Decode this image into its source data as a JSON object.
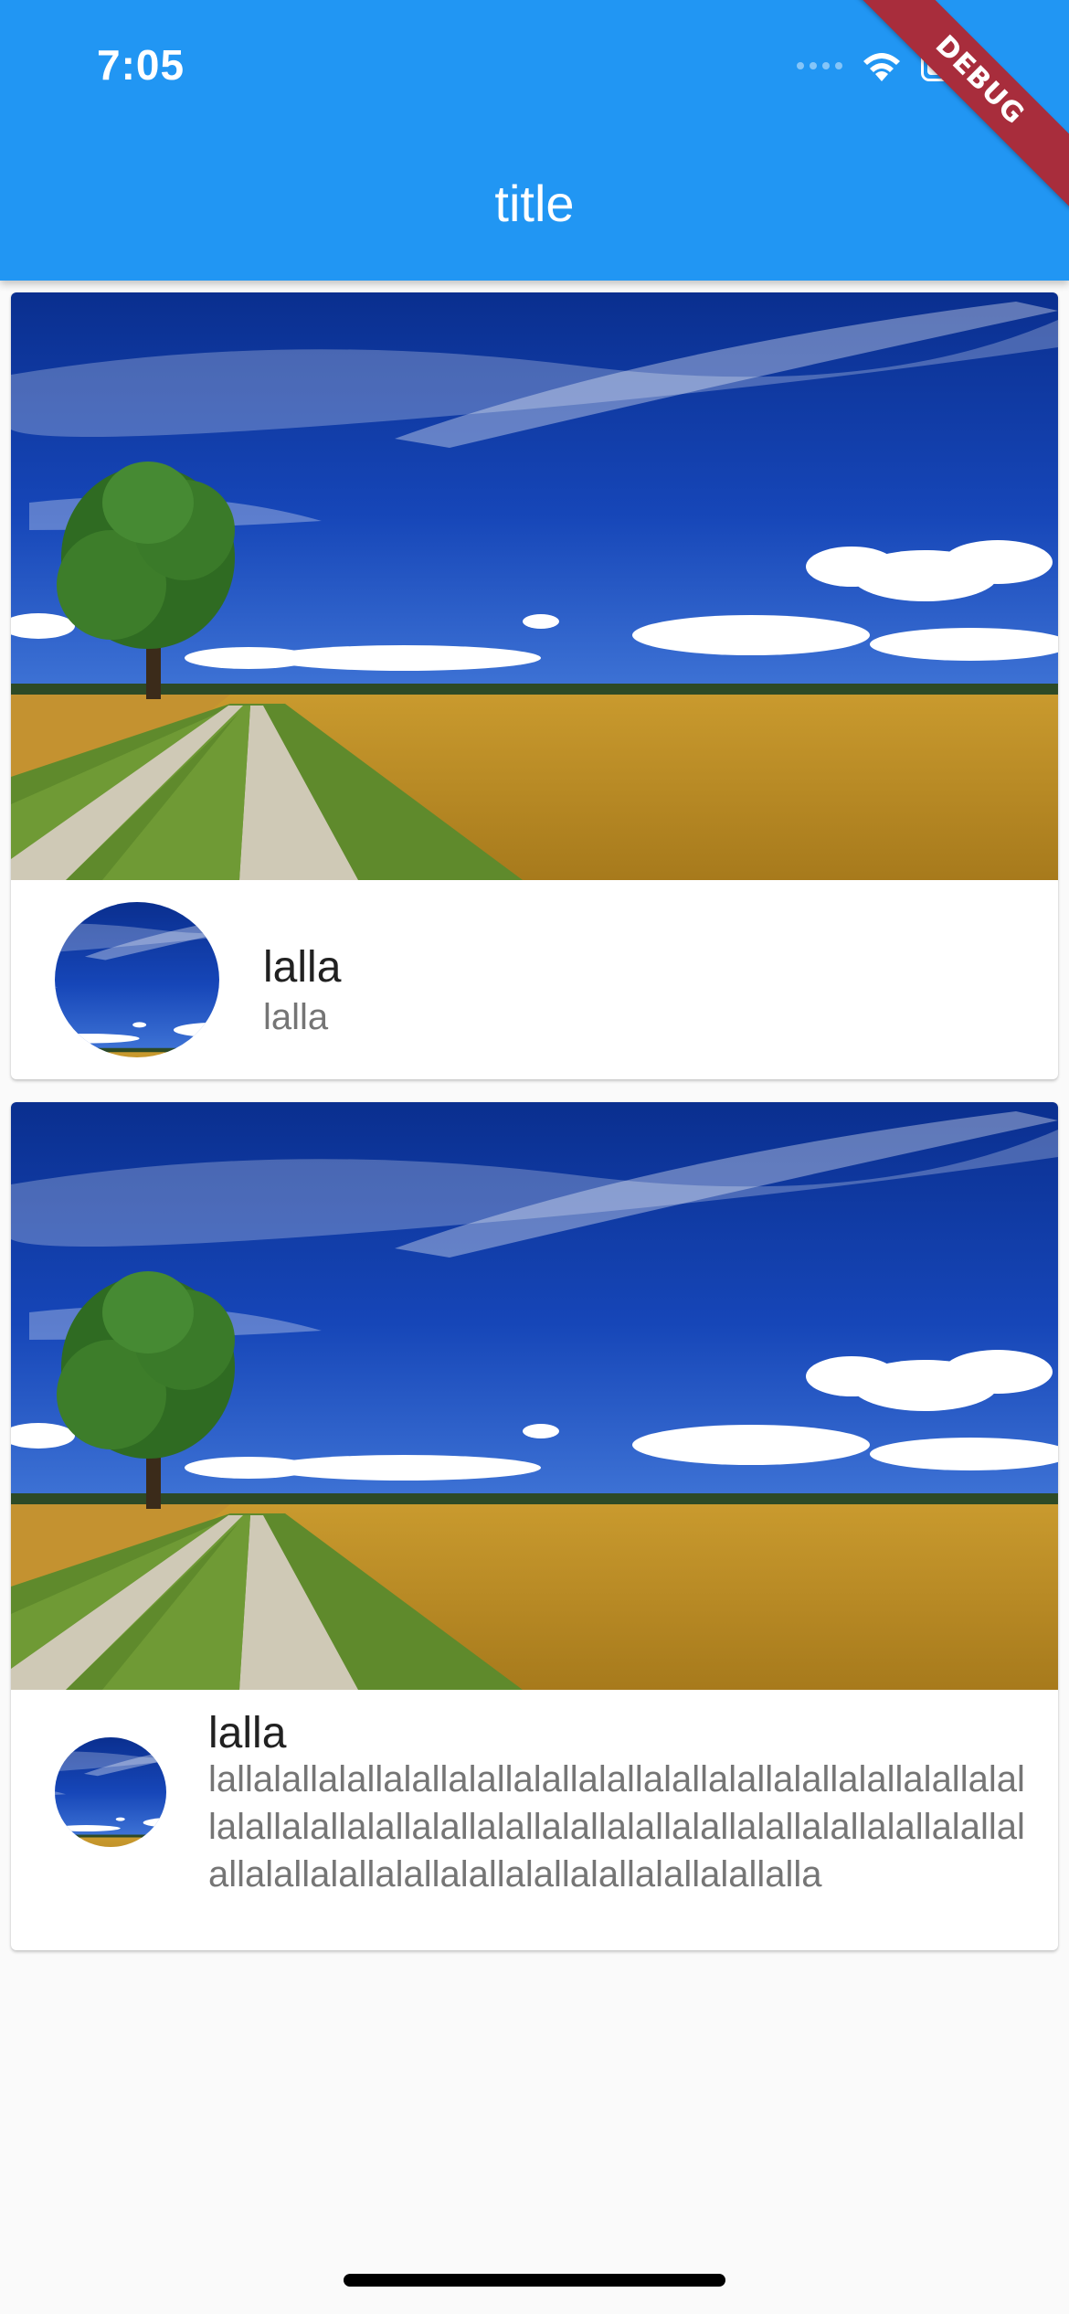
{
  "status_bar": {
    "time": "7:05"
  },
  "app_bar": {
    "title": "title"
  },
  "debug_banner": "DEBUG",
  "cards": [
    {
      "title": "lalla",
      "subtitle": "lalla"
    },
    {
      "title": "lalla",
      "subtitle": "lallalallalallalallalallalallalallalallalallalallalallalallalallalallalallalallalallalallalallalallalallalallalallalallalallalallalallalallalallalallalallalallalallalallalla"
    }
  ],
  "colors": {
    "app_bar": "#2196f3",
    "background": "#fafafa",
    "debug_banner": "#a82d3c"
  }
}
